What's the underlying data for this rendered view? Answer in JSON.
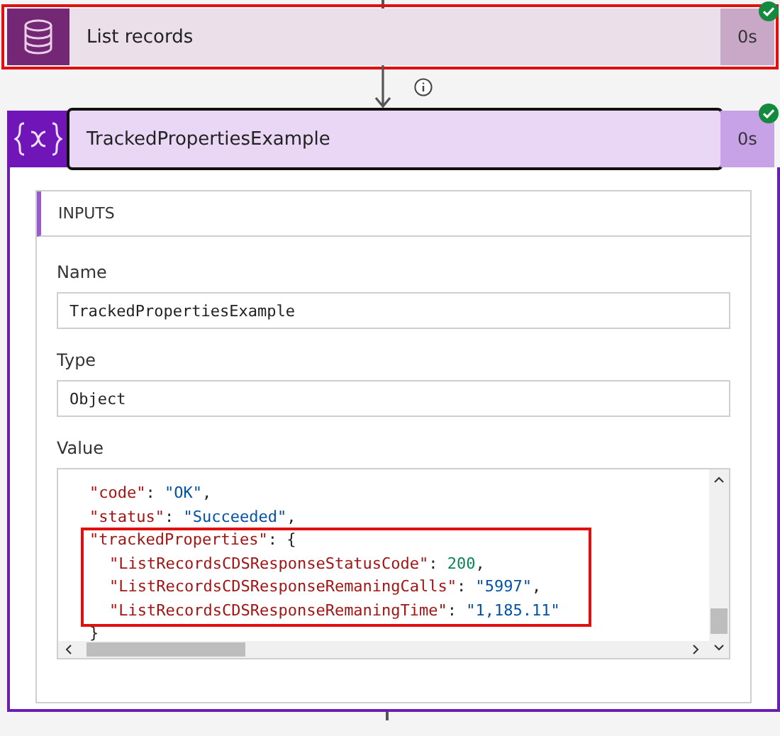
{
  "steps": [
    {
      "kind": "database",
      "title": "List records",
      "duration": "0s",
      "succeeded": true,
      "highlighted": true,
      "expanded": false
    },
    {
      "kind": "variable",
      "title": "TrackedPropertiesExample",
      "duration": "0s",
      "succeeded": true,
      "highlighted": false,
      "expanded": true,
      "inputs": {
        "header": "INPUTS",
        "fields": [
          {
            "label": "Name",
            "value": "TrackedPropertiesExample"
          },
          {
            "label": "Type",
            "value": "Object"
          }
        ],
        "value_label": "Value",
        "code_lines": [
          {
            "highlighted": false,
            "tokens": [
              {
                "kind": "key",
                "text": "\"code\""
              },
              {
                "kind": "punct",
                "text": ": "
              },
              {
                "kind": "string",
                "text": "\"OK\""
              },
              {
                "kind": "punct",
                "text": ","
              }
            ]
          },
          {
            "highlighted": false,
            "tokens": [
              {
                "kind": "key",
                "text": "\"status\""
              },
              {
                "kind": "punct",
                "text": ": "
              },
              {
                "kind": "string",
                "text": "\"Succeeded\""
              },
              {
                "kind": "punct",
                "text": ","
              }
            ]
          },
          {
            "highlighted": true,
            "tokens": [
              {
                "kind": "key",
                "text": "\"trackedProperties\""
              },
              {
                "kind": "punct",
                "text": ": {"
              }
            ],
            "children": [
              {
                "tokens": [
                  {
                    "kind": "key",
                    "text": "\"ListRecordsCDSResponseStatusCode\""
                  },
                  {
                    "kind": "punct",
                    "text": ": "
                  },
                  {
                    "kind": "number",
                    "text": "200"
                  },
                  {
                    "kind": "punct",
                    "text": ","
                  }
                ]
              },
              {
                "tokens": [
                  {
                    "kind": "key",
                    "text": "\"ListRecordsCDSResponseRemaningCalls\""
                  },
                  {
                    "kind": "punct",
                    "text": ": "
                  },
                  {
                    "kind": "string",
                    "text": "\"5997\""
                  },
                  {
                    "kind": "punct",
                    "text": ","
                  }
                ]
              },
              {
                "tokens": [
                  {
                    "kind": "key",
                    "text": "\"ListRecordsCDSResponseRemaningTime\""
                  },
                  {
                    "kind": "punct",
                    "text": ": "
                  },
                  {
                    "kind": "string",
                    "text": "\"1,185.11\""
                  }
                ]
              }
            ]
          },
          {
            "highlighted": false,
            "tokens": [
              {
                "kind": "punct",
                "text": "}"
              }
            ]
          }
        ]
      }
    }
  ]
}
